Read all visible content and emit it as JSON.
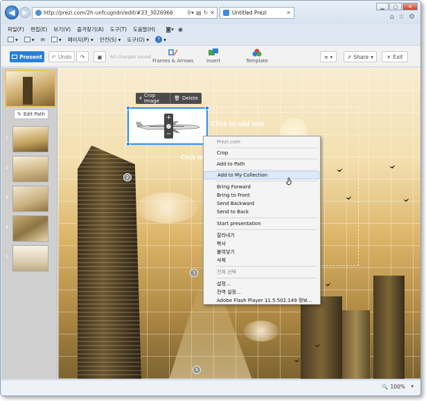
{
  "browser": {
    "url": "http://prezi.com/2h-unfcugndn/edit/#33_3026966",
    "tab_title": "Untitled Prezi",
    "menu": [
      "파일(F)",
      "편집(E)",
      "보기(V)",
      "즐겨찾기(A)",
      "도구(T)",
      "도움말(H)"
    ],
    "commands": [
      "페이지(P) ▾",
      "안전(S) ▾",
      "도구(O) ▾"
    ],
    "zoom": "100%"
  },
  "toolbar": {
    "present": "Present",
    "undo": "Undo",
    "saved_note": "All changes saved",
    "frames": "Frames & Arrows",
    "insert": "Insert",
    "template": "Template",
    "share": "Share",
    "exit": "Exit"
  },
  "sidebar": {
    "edit_path": "Edit Path",
    "path_numbers": [
      "1",
      "2",
      "3",
      "4",
      "5"
    ]
  },
  "canvas": {
    "click_to_add_text": "Click to add text",
    "click_to_add_text_2": "Click to",
    "markers": [
      "2",
      "3",
      "4"
    ]
  },
  "image_toolbar": {
    "crop": "Crop Image",
    "delete": "Delete"
  },
  "context_menu": {
    "header": "Prezi.com",
    "items": {
      "crop": "Crop",
      "add_to_path": "Add to Path",
      "add_to_collection": "Add to My Collection",
      "bring_forward": "Bring Forward",
      "bring_to_front": "Bring to Front",
      "send_backward": "Send Backward",
      "send_to_back": "Send to Back",
      "start_presentation": "Start presentation",
      "cut": "잘라내기",
      "copy": "복사",
      "paste": "붙여넣기",
      "delete": "삭제",
      "select_all": "전체 선택",
      "settings": "설정...",
      "global_settings": "전역 설정...",
      "flash_info": "Adobe Flash Player 11.5.502.149 정보..."
    }
  },
  "colors": {
    "present_blue": "#2b7fd8",
    "selection_blue": "#2a8cf0",
    "menu_highlight": "#dde9f8"
  }
}
